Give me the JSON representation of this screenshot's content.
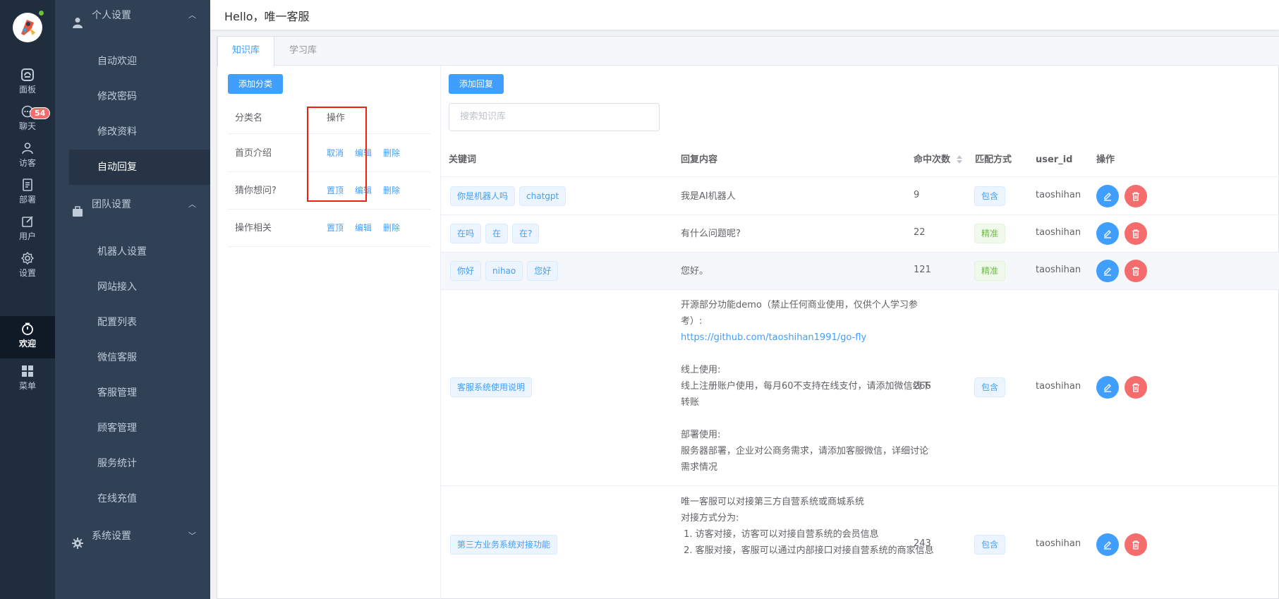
{
  "rail": {
    "badge": "54",
    "items": [
      {
        "label": "面板",
        "icon": "dashboard-icon"
      },
      {
        "label": "聊天",
        "icon": "chat-icon"
      },
      {
        "label": "访客",
        "icon": "visitor-icon"
      },
      {
        "label": "部署",
        "icon": "deploy-icon"
      },
      {
        "label": "用户",
        "icon": "user-edit-icon"
      },
      {
        "label": "设置",
        "icon": "settings-icon"
      },
      {
        "label": "欢迎",
        "icon": "timer-icon"
      },
      {
        "label": "菜单",
        "icon": "grid-icon"
      }
    ]
  },
  "menu": {
    "group_personal": "个人设置",
    "personal_items": [
      "自动欢迎",
      "修改密码",
      "修改资料",
      "自动回复"
    ],
    "group_team": "团队设置",
    "team_items": [
      "机器人设置",
      "网站接入",
      "配置列表",
      "微信客服",
      "客服管理",
      "顾客管理",
      "服务统计",
      "在线充值"
    ],
    "group_system": "系统设置"
  },
  "header": {
    "greeting": "Hello，唯一客服"
  },
  "tabs": [
    "知识库",
    "学习库"
  ],
  "categories": {
    "add_button": "添加分类",
    "col_name": "分类名",
    "col_action": "操作",
    "rows": [
      {
        "name": "首页介绍",
        "pin": "取消",
        "edit": "编辑",
        "delete": "删除"
      },
      {
        "name": "猜你想问?",
        "pin": "置顶",
        "edit": "编辑",
        "delete": "删除"
      },
      {
        "name": "操作相关",
        "pin": "置顶",
        "edit": "编辑",
        "delete": "删除"
      }
    ]
  },
  "knowledge": {
    "add_button": "添加回复",
    "search_placeholder": "搜索知识库",
    "columns": {
      "keyword": "关键词",
      "reply": "回复内容",
      "hits": "命中次数",
      "match": "匹配方式",
      "user": "user_id",
      "action": "操作"
    },
    "rows": [
      {
        "keywords": [
          "你是机器人吗",
          "chatgpt"
        ],
        "reply_lines": [
          "我是AI机器人"
        ],
        "hits": "9",
        "match": "包含",
        "match_color": "#409eff",
        "user": "taoshihan"
      },
      {
        "keywords": [
          "在吗",
          "在",
          "在?"
        ],
        "reply_lines": [
          "有什么问题呢?"
        ],
        "hits": "22",
        "match": "精准",
        "match_color": "#67c23a",
        "user": "taoshihan"
      },
      {
        "keywords": [
          "你好",
          "nihao",
          "您好"
        ],
        "reply_lines": [
          "您好。"
        ],
        "hits": "121",
        "match": "精准",
        "match_color": "#67c23a",
        "user": "taoshihan"
      },
      {
        "keywords": [
          "客服系统使用说明"
        ],
        "reply_lines": [
          "开源部分功能demo（禁止任何商业使用，仅供个人学习参考）:",
          "https://github.com/taoshihan1991/go-fly",
          "",
          "线上使用:",
          "线上注册账户使用，每月60不支持在线支付，请添加微信线下转账",
          "",
          "部署使用:",
          "服务器部署，企业对公商务需求，请添加客服微信，详细讨论需求情况"
        ],
        "hits": "266",
        "match": "包含",
        "match_color": "#409eff",
        "user": "taoshihan"
      },
      {
        "keywords": [
          "第三方业务系统对接功能"
        ],
        "reply_lines": [
          "唯一客服可以对接第三方自营系统或商城系统",
          "对接方式分为:",
          " 1. 访客对接，访客可以对接自营系统的会员信息",
          " 2. 客服对接，客服可以通过内部接口对接自营系统的商家信息"
        ],
        "hits": "243",
        "match": "包含",
        "match_color": "#409eff",
        "user": "taoshihan"
      }
    ]
  }
}
